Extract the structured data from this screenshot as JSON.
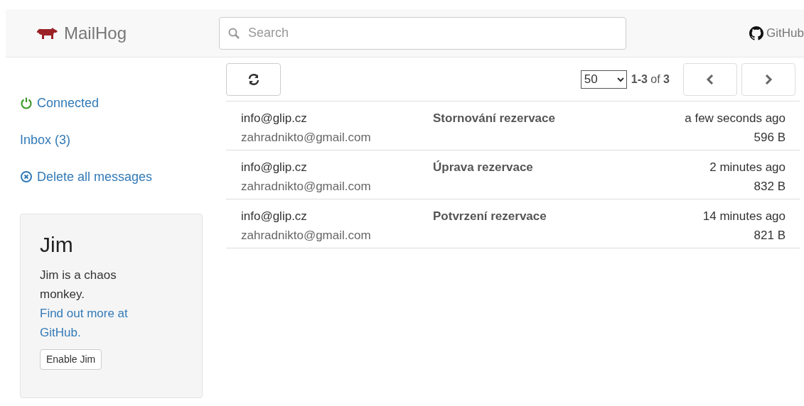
{
  "navbar": {
    "brand": "MailHog",
    "search": {
      "placeholder": "Search"
    },
    "github_link": "GitHub"
  },
  "sidebar": {
    "items": [
      {
        "kind": "status",
        "label": "Connected"
      },
      {
        "kind": "inbox",
        "label": "Inbox (3)"
      },
      {
        "kind": "delete",
        "label": "Delete all messages"
      }
    ],
    "jim": {
      "title": "Jim",
      "description": "Jim is a chaos monkey.",
      "link": "Find out more at GitHub.",
      "button": "Enable Jim"
    }
  },
  "toolbar": {
    "page_size": "50",
    "range": "**1-3** of **3**"
  },
  "messages": [
    {
      "from": "info@glip.cz",
      "to": "zahradnikto@gmail.com",
      "subject": "Stornování rezervace",
      "time": "a few seconds ago",
      "size": "596 B"
    },
    {
      "from": "info@glip.cz",
      "to": "zahradnikto@gmail.com",
      "subject": "Úprava rezervace",
      "time": "2 minutes ago",
      "size": "832 B"
    },
    {
      "from": "info@glip.cz",
      "to": "zahradnikto@gmail.com",
      "subject": "Potvrzení rezervace",
      "time": "14 minutes ago",
      "size": "821 B"
    }
  ]
}
